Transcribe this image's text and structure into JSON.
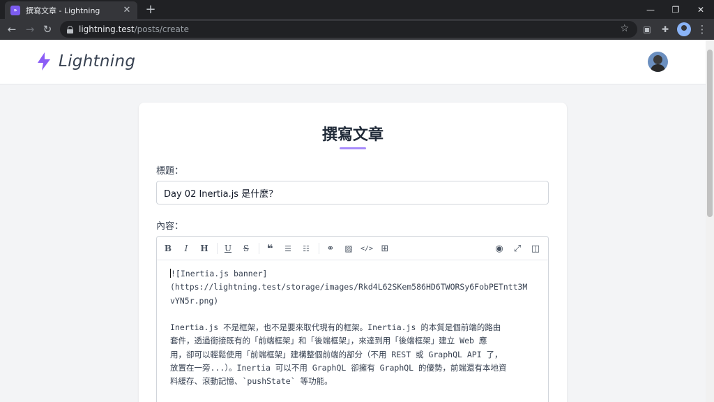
{
  "browser": {
    "tab_title": "撰寫文章 - Lightning",
    "favicon_text": "»",
    "url_host": "lightning.test",
    "url_path": "/posts/create"
  },
  "site": {
    "brand_name": "Lightning"
  },
  "form": {
    "heading": "撰寫文章",
    "title_label": "標題：",
    "title_value": "Day 02 Inertia.js 是什麼？",
    "content_label": "內容：",
    "content_lines": [
      "![Inertia.js banner]",
      "(https://lightning.test/storage/images/Rkd4L62SKem586HD6TWORSy6FobPETntt3M",
      "vYN5r.png)"
    ],
    "content_paragraph": [
      "Inertia.js 不是框架，也不是要來取代現有的框架。Inertia.js 的本質是個前端的路由",
      "套件，透過銜接既有的「前端框架」和「後端框架」，來達到用「後端框架」建立 Web 應",
      "用，卻可以輕鬆使用「前端框架」建構整個前端的部分（不用 REST 或 GraphQL API 了，",
      "放置在一旁...）。Inertia 可以不用 GraphQL 卻擁有 GraphQL 的優勢，前端還有本地資",
      "料緩存、滾動記憶、`pushState` 等功能。"
    ]
  },
  "colors": {
    "accent": "#a78bfa",
    "brand_bolt": "#8b5cf6"
  }
}
